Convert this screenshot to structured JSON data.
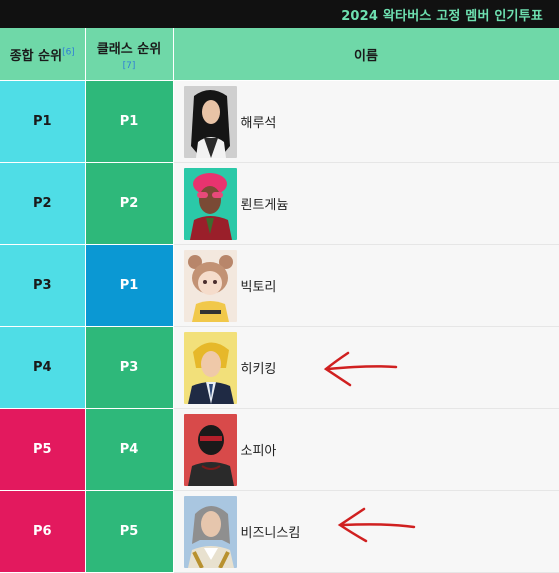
{
  "caption": "2024 왁타버스 고정 멤버 인기투표",
  "headers": {
    "overall": "종합 순위",
    "overall_note": "[6]",
    "class": "클래스 순위",
    "class_note": "[7]",
    "name": "이름"
  },
  "colors": {
    "overall_cyan": "#4fdde6",
    "overall_pink": "#e3195e",
    "class_green": "#2eb87a",
    "class_blue": "#0b98d3",
    "header_green": "#6fd8a8",
    "arrow_red": "#d02020"
  },
  "rows": [
    {
      "overall": "P1",
      "class": "P1",
      "name": "해루석",
      "overall_color": "cyan",
      "class_color": "green",
      "avatar_icon": "long-black-hair-avatar-icon"
    },
    {
      "overall": "P2",
      "class": "P2",
      "name": "뢴트게늄",
      "overall_color": "cyan",
      "class_color": "green",
      "avatar_icon": "pink-hair-sunglasses-avatar-icon"
    },
    {
      "overall": "P3",
      "class": "P1",
      "name": "빅토리",
      "overall_color": "cyan",
      "class_color": "blue",
      "avatar_icon": "bear-ears-girl-avatar-icon"
    },
    {
      "overall": "P4",
      "class": "P3",
      "name": "히키킹",
      "overall_color": "cyan",
      "class_color": "green",
      "avatar_icon": "blonde-suit-avatar-icon",
      "arrow": true
    },
    {
      "overall": "P5",
      "class": "P4",
      "name": "소피아",
      "overall_color": "pink",
      "class_color": "green",
      "avatar_icon": "masked-figure-avatar-icon"
    },
    {
      "overall": "P6",
      "class": "P5",
      "name": "비즈니스킴",
      "overall_color": "pink",
      "class_color": "green",
      "avatar_icon": "gray-hair-noble-avatar-icon",
      "arrow": true
    }
  ]
}
